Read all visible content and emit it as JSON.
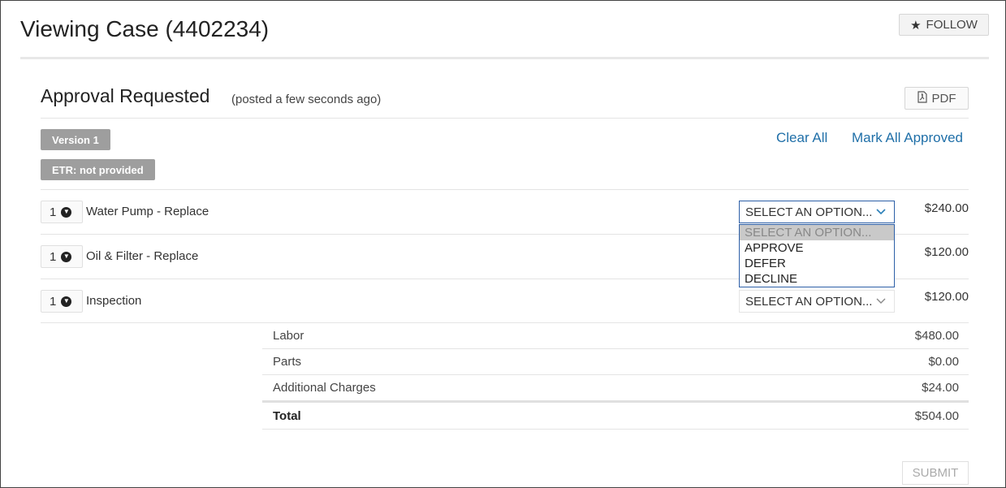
{
  "header": {
    "title": "Viewing Case (4402234)",
    "follow_label": "FOLLOW",
    "follow_icon": "star-icon"
  },
  "approval": {
    "title": "Approval Requested",
    "posted": "(posted a few seconds ago)",
    "pdf_label": "PDF",
    "version_badge": "Version 1",
    "etr_badge": "ETR: not provided",
    "clear_all": "Clear All",
    "mark_all_approved": "Mark All Approved"
  },
  "items": [
    {
      "qty": "1",
      "label": "Water Pump - Replace",
      "select_value": "SELECT AN OPTION...",
      "price": "$240.00"
    },
    {
      "qty": "1",
      "label": "Oil & Filter - Replace",
      "select_value": "SELECT AN OPTION...",
      "price": "$120.00"
    },
    {
      "qty": "1",
      "label": "Inspection",
      "select_value": "SELECT AN OPTION...",
      "price": "$120.00"
    }
  ],
  "dropdown": {
    "options": [
      "SELECT AN OPTION...",
      "APPROVE",
      "DEFER",
      "DECLINE"
    ]
  },
  "summary": {
    "labor_label": "Labor",
    "labor": "$480.00",
    "parts_label": "Parts",
    "parts": "$0.00",
    "additional_label": "Additional Charges",
    "additional": "$24.00",
    "total_label": "Total",
    "total": "$504.00"
  },
  "submit_label": "SUBMIT",
  "colors": {
    "link": "#1f6fa8",
    "badge": "#9e9e9e",
    "select_focus": "#2d5fa7"
  }
}
